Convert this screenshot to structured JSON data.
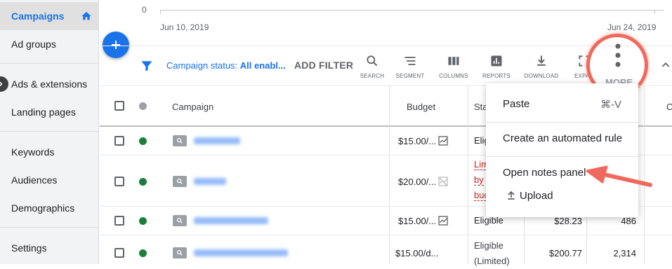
{
  "sidebar": {
    "items": [
      {
        "label": "Campaigns"
      },
      {
        "label": "Ad groups"
      },
      {
        "label": "Ads & extensions"
      },
      {
        "label": "Landing pages"
      },
      {
        "label": "Keywords"
      },
      {
        "label": "Audiences"
      },
      {
        "label": "Demographics"
      },
      {
        "label": "Settings"
      }
    ]
  },
  "chart": {
    "y_zero": "0",
    "start_date": "Jun 10, 2019",
    "end_date": "Jun 24, 2019"
  },
  "toolbar": {
    "filter_prefix": "Campaign status: ",
    "filter_value": "All enabl...",
    "add_filter": "ADD FILTER",
    "tools": [
      {
        "label": "SEARCH",
        "icon": "search-icon"
      },
      {
        "label": "SEGMENT",
        "icon": "segment-icon"
      },
      {
        "label": "COLUMNS",
        "icon": "columns-icon"
      },
      {
        "label": "REPORTS",
        "icon": "reports-icon"
      },
      {
        "label": "DOWNLOAD",
        "icon": "download-icon"
      },
      {
        "label": "EXPA",
        "icon": "expand-icon"
      }
    ],
    "more_label": "MORE"
  },
  "table": {
    "headers": {
      "campaign": "Campaign",
      "budget": "Budget",
      "status": "Sta",
      "last": "C"
    },
    "rows": [
      {
        "budget": "$15.00/...",
        "status": [
          "Eligib"
        ],
        "cost": "",
        "conv": "",
        "status_color": "normal"
      },
      {
        "budget": "$20.00/...",
        "status": [
          "Lim",
          "by",
          "bud"
        ],
        "cost": "",
        "conv": "",
        "status_color": "limited"
      },
      {
        "budget": "$15.00/...",
        "status": [
          "Eligible"
        ],
        "cost": "$28.23",
        "conv": "486",
        "status_color": "normal"
      },
      {
        "budget": "$15.00/d...",
        "status": [
          "Eligible",
          "(Limited)"
        ],
        "cost": "$200.77",
        "conv": "2,314",
        "status_color": "normal"
      }
    ]
  },
  "menu": {
    "paste": "Paste",
    "paste_shortcut": "⌘-V",
    "automated_rule": "Create an automated rule",
    "notes_panel": "Open notes panel",
    "upload": "Upload"
  },
  "colors": {
    "accent": "#1a73e8",
    "active_dot": "#188038",
    "highlight": "#ef6a5c"
  }
}
